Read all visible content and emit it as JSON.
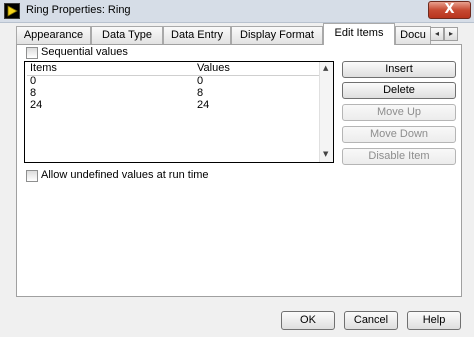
{
  "window": {
    "title": "Ring Properties: Ring",
    "close_label": "X"
  },
  "tabs": [
    {
      "label": "Appearance"
    },
    {
      "label": "Data Type"
    },
    {
      "label": "Data Entry"
    },
    {
      "label": "Display Format"
    },
    {
      "label": "Edit Items",
      "active": true
    },
    {
      "label": "Docu"
    }
  ],
  "tab_scroll": {
    "left": "◂",
    "right": "▸"
  },
  "sequential_values": {
    "label": "Sequential values",
    "checked": false
  },
  "items_table": {
    "headers": [
      "Items",
      "Values"
    ],
    "rows": [
      {
        "item": "0",
        "value": "0"
      },
      {
        "item": "8",
        "value": "8"
      },
      {
        "item": "24",
        "value": "24"
      }
    ],
    "scroll_up": "▲",
    "scroll_down": "▼"
  },
  "side_buttons": {
    "insert": "Insert",
    "delete": "Delete",
    "move_up": "Move Up",
    "move_down": "Move Down",
    "disable_item": "Disable Item"
  },
  "allow_undefined": {
    "label": "Allow undefined values at run time",
    "checked": false
  },
  "dialog_buttons": {
    "ok": "OK",
    "cancel": "Cancel",
    "help": "Help"
  }
}
